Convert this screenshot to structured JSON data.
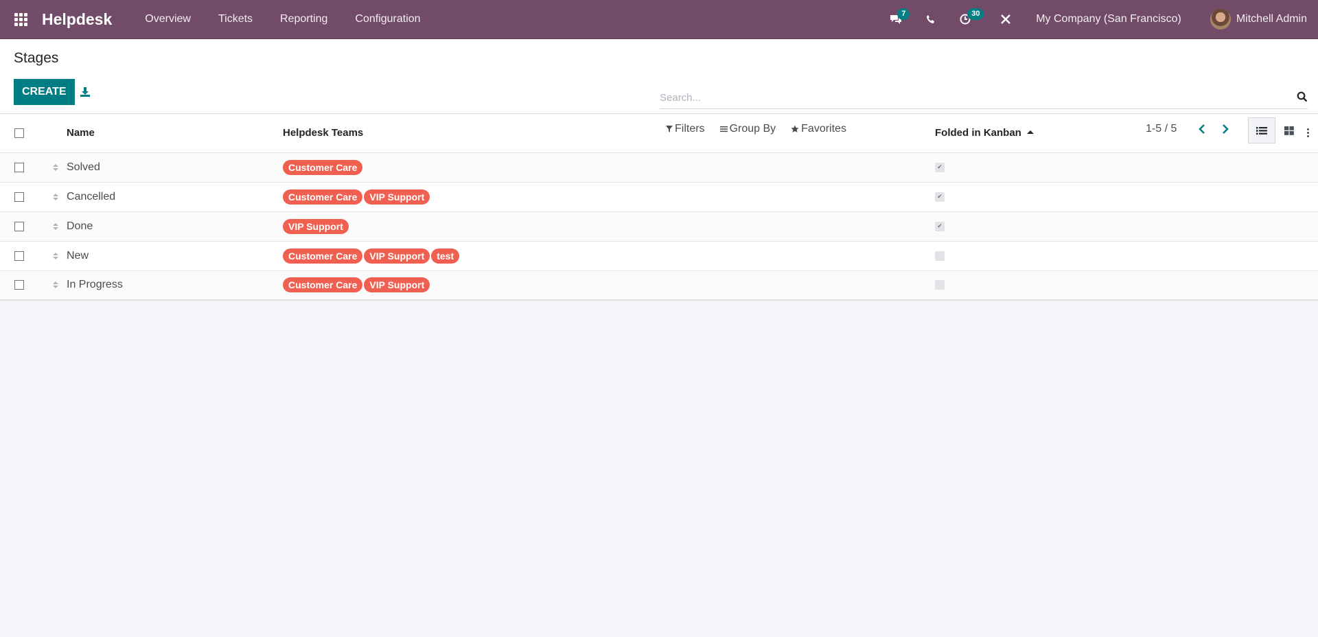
{
  "navbar": {
    "brand": "Helpdesk",
    "menu": [
      {
        "label": "Overview"
      },
      {
        "label": "Tickets"
      },
      {
        "label": "Reporting"
      },
      {
        "label": "Configuration"
      }
    ],
    "messages_badge": "7",
    "activities_badge": "30",
    "company": "My Company (San Francisco)",
    "user": "Mitchell Admin"
  },
  "control_panel": {
    "title": "Stages",
    "create_label": "CREATE",
    "search_placeholder": "Search...",
    "filters_label": "Filters",
    "groupby_label": "Group By",
    "favorites_label": "Favorites",
    "pager": "1-5 / 5"
  },
  "table": {
    "columns": {
      "name": "Name",
      "teams": "Helpdesk Teams",
      "folded": "Folded in Kanban"
    },
    "rows": [
      {
        "name": "Solved",
        "teams": [
          "Customer Care"
        ],
        "folded": true
      },
      {
        "name": "Cancelled",
        "teams": [
          "Customer Care",
          "VIP Support"
        ],
        "folded": true
      },
      {
        "name": "Done",
        "teams": [
          "VIP Support"
        ],
        "folded": true
      },
      {
        "name": "New",
        "teams": [
          "Customer Care",
          "VIP Support",
          "test"
        ],
        "folded": false
      },
      {
        "name": "In Progress",
        "teams": [
          "Customer Care",
          "VIP Support"
        ],
        "folded": false
      }
    ]
  },
  "colors": {
    "navbar": "#714b67",
    "primary": "#017e84",
    "tag": "#f06050"
  }
}
